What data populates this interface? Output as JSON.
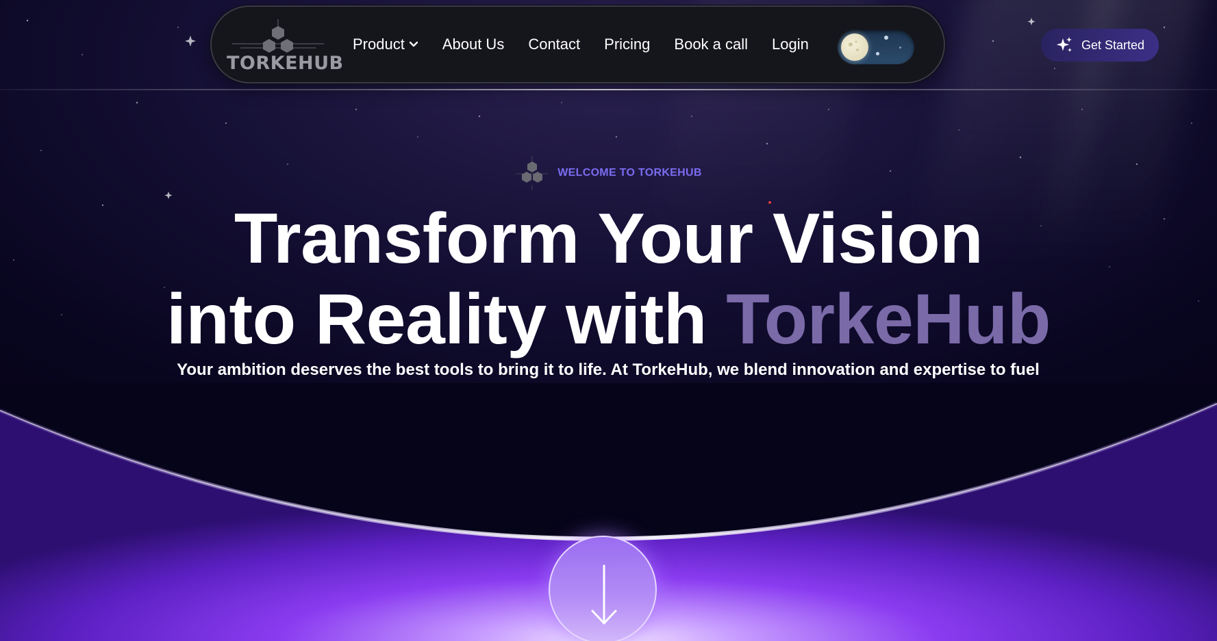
{
  "brand": {
    "logo_text": "TORKEHUB",
    "accent_color": "#7b6cf0",
    "glow_color": "#8a3cf0"
  },
  "nav": {
    "items": [
      {
        "label": "Product",
        "has_dropdown": true
      },
      {
        "label": "About Us"
      },
      {
        "label": "Contact"
      },
      {
        "label": "Pricing"
      },
      {
        "label": "Book a call"
      },
      {
        "label": "Login"
      }
    ],
    "theme_toggle": {
      "icon": "moon-icon",
      "state": "dark"
    }
  },
  "cta": {
    "get_started_label": "Get Started",
    "icon": "sparkle-icon"
  },
  "hero": {
    "welcome_label": "WELCOME TO TORKEHUB",
    "title_line1": "Transform Your Vision",
    "title_line2_prefix": "into Reality with ",
    "title_brand": "TorkeHub",
    "subtitle": "Your ambition deserves the best tools to bring it to life. At TorkeHub, we blend innovation and expertise to fuel your success. Our passion for excellence meets your drive for greatness, creating a seamless path to your business goals.",
    "scroll_icon": "arrow-down-icon"
  }
}
